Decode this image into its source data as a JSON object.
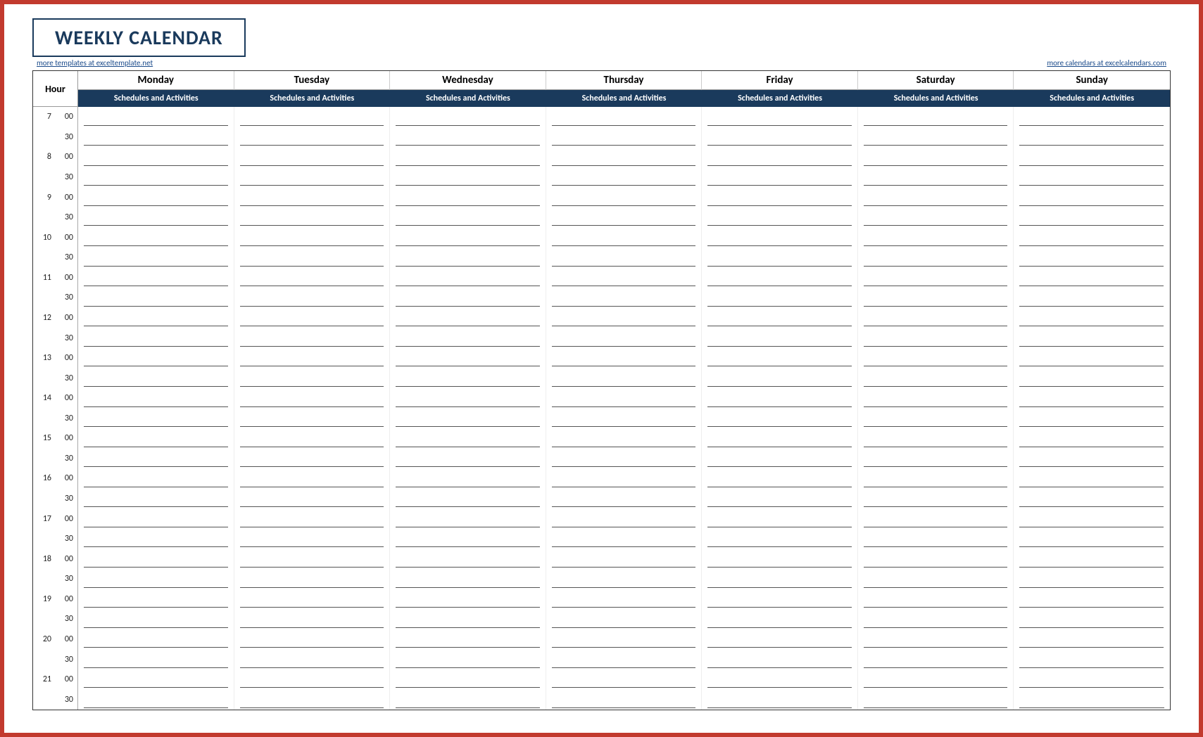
{
  "title": "WEEKLY CALENDAR",
  "link_left": "more templates at exceltemplate.net",
  "link_right": "more calendars at excelcalendars.com",
  "hour_header": "Hour",
  "subheader_label": "Schedules and Activities",
  "days": [
    "Monday",
    "Tuesday",
    "Wednesday",
    "Thursday",
    "Friday",
    "Saturday",
    "Sunday"
  ],
  "hours": [
    7,
    8,
    9,
    10,
    11,
    12,
    13,
    14,
    15,
    16,
    17,
    18,
    19,
    20,
    21
  ],
  "minute_labels": [
    "00",
    "30"
  ]
}
